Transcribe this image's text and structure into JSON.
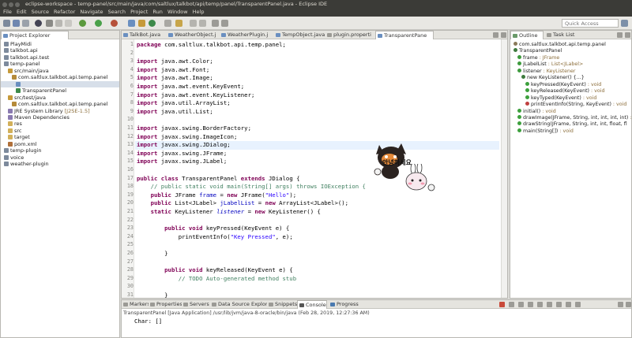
{
  "window": {
    "title": "eclipse-workspace - temp-panel/src/main/java/com/saltlux/talkbot/api/temp/panel/TransparentPanel.java - Eclipse IDE"
  },
  "menu": [
    "File",
    "Edit",
    "Source",
    "Refactor",
    "Navigate",
    "Search",
    "Project",
    "Run",
    "Window",
    "Help"
  ],
  "toolbar": {
    "quick_access_placeholder": "Quick Access"
  },
  "explorer": {
    "tab_label": "Project Explorer",
    "items": [
      {
        "label": "PlayMidi",
        "indent": 0,
        "icon": "project-icon"
      },
      {
        "label": "talkbot.api",
        "indent": 0,
        "icon": "project-icon"
      },
      {
        "label": "talkbot.api.test",
        "indent": 0,
        "icon": "project-icon"
      },
      {
        "label": "temp-panel",
        "indent": 0,
        "icon": "project-icon"
      },
      {
        "label": "src/main/java",
        "indent": 1,
        "icon": "source-folder-icon"
      },
      {
        "label": "com.saltlux.talkbot.api.temp.panel",
        "indent": 2,
        "icon": "package-icon"
      },
      {
        "label": "",
        "indent": 3,
        "icon": "java-file-icon",
        "selected": true
      },
      {
        "label": "TransparentPanel",
        "indent": 3,
        "icon": "class-icon"
      },
      {
        "label": "src/test/java",
        "indent": 1,
        "icon": "source-folder-icon"
      },
      {
        "label": "com.saltlux.talkbot.api.temp.panel",
        "indent": 2,
        "icon": "package-icon"
      },
      {
        "label": "JRE System Library",
        "suffix": "[J2SE-1.5]",
        "indent": 1,
        "icon": "library-icon"
      },
      {
        "label": "Maven Dependencies",
        "indent": 1,
        "icon": "library-icon"
      },
      {
        "label": "res",
        "indent": 1,
        "icon": "folder-icon"
      },
      {
        "label": "src",
        "indent": 1,
        "icon": "folder-icon"
      },
      {
        "label": "target",
        "indent": 1,
        "icon": "folder-icon"
      },
      {
        "label": "pom.xml",
        "indent": 1,
        "icon": "xml-file-icon"
      },
      {
        "label": "temp-plugin",
        "indent": 0,
        "icon": "project-icon"
      },
      {
        "label": "voice",
        "indent": 0,
        "icon": "project-icon"
      },
      {
        "label": "weather-plugin",
        "indent": 0,
        "icon": "project-icon"
      }
    ]
  },
  "editor": {
    "tabs": [
      {
        "label": "TalkBot.java"
      },
      {
        "label": "WeatherObject.j"
      },
      {
        "label": "WeatherPlugin.j"
      },
      {
        "label": "TempObject.java"
      },
      {
        "label": "plugin.properti"
      },
      {
        "label": "TransparentPane",
        "active": true
      }
    ],
    "line_numbers": [
      "1",
      "2",
      "3",
      "4",
      "5",
      "6",
      "7",
      "8",
      "9",
      "10",
      "11",
      "12",
      "13",
      "14",
      "15",
      "16",
      "17",
      "18",
      "19",
      "20",
      "21",
      "22",
      "23",
      "24",
      "25",
      "26",
      "27",
      "28",
      "29",
      "30",
      "31"
    ],
    "lines": [
      [
        {
          "t": "package",
          "c": "kw"
        },
        {
          "t": " com.saltlux.talkbot.api.temp.panel;"
        }
      ],
      [],
      [
        {
          "t": "import",
          "c": "kw"
        },
        {
          "t": " java.awt.Color;"
        }
      ],
      [
        {
          "t": "import",
          "c": "kw"
        },
        {
          "t": " java.awt.Font;"
        }
      ],
      [
        {
          "t": "import",
          "c": "kw"
        },
        {
          "t": " java.awt.Image;"
        }
      ],
      [
        {
          "t": "import",
          "c": "kw"
        },
        {
          "t": " java.awt.event.KeyEvent;"
        }
      ],
      [
        {
          "t": "import",
          "c": "kw"
        },
        {
          "t": " java.awt.event.KeyListener;"
        }
      ],
      [
        {
          "t": "import",
          "c": "kw"
        },
        {
          "t": " java.util.ArrayList;"
        }
      ],
      [
        {
          "t": "import",
          "c": "kw"
        },
        {
          "t": " java.util.List;"
        }
      ],
      [],
      [
        {
          "t": "import",
          "c": "kw"
        },
        {
          "t": " javax.swing.BorderFactory;"
        }
      ],
      [
        {
          "t": "import",
          "c": "kw"
        },
        {
          "t": " javax.swing.ImageIcon;"
        }
      ],
      [
        {
          "t": "import",
          "c": "kw"
        },
        {
          "t": " javax.swing.JDialog;"
        }
      ],
      [
        {
          "t": "import",
          "c": "kw"
        },
        {
          "t": " javax.swing.JFrame;"
        }
      ],
      [
        {
          "t": "import",
          "c": "kw"
        },
        {
          "t": " javax.swing.JLabel;"
        }
      ],
      [],
      [
        {
          "t": "public class",
          "c": "kw"
        },
        {
          "t": " TransparentPanel "
        },
        {
          "t": "extends",
          "c": "kw"
        },
        {
          "t": " JDialog {"
        }
      ],
      [
        {
          "t": "    // public static void main(String[] args) throws IOException {",
          "c": "cmt"
        }
      ],
      [
        {
          "t": "    "
        },
        {
          "t": "public",
          "c": "kw"
        },
        {
          "t": " JFrame "
        },
        {
          "t": "frame",
          "c": "fld"
        },
        {
          "t": " = "
        },
        {
          "t": "new",
          "c": "kw"
        },
        {
          "t": " JFrame("
        },
        {
          "t": "\"Hello\"",
          "c": "str"
        },
        {
          "t": ");"
        }
      ],
      [
        {
          "t": "    "
        },
        {
          "t": "public",
          "c": "kw"
        },
        {
          "t": " List<JLabel> "
        },
        {
          "t": "jLabelList",
          "c": "fld"
        },
        {
          "t": " = "
        },
        {
          "t": "new",
          "c": "kw"
        },
        {
          "t": " ArrayList<JLabel>();"
        }
      ],
      [
        {
          "t": "    "
        },
        {
          "t": "static",
          "c": "kw"
        },
        {
          "t": " KeyListener "
        },
        {
          "t": "listener",
          "c": "ital"
        },
        {
          "t": " = "
        },
        {
          "t": "new",
          "c": "kw"
        },
        {
          "t": " KeyListener() {"
        }
      ],
      [],
      [
        {
          "t": "        "
        },
        {
          "t": "public void",
          "c": "kw"
        },
        {
          "t": " keyPressed(KeyEvent e) {"
        }
      ],
      [
        {
          "t": "            printEventInfo("
        },
        {
          "t": "\"Key Pressed\"",
          "c": "str"
        },
        {
          "t": ", e);"
        }
      ],
      [],
      [
        {
          "t": "        }"
        }
      ],
      [],
      [
        {
          "t": "        "
        },
        {
          "t": "public void",
          "c": "kw"
        },
        {
          "t": " keyReleased(KeyEvent e) {"
        }
      ],
      [
        {
          "t": "            // TODO Auto-generated method stub",
          "c": "cmt"
        }
      ],
      [],
      [
        {
          "t": "        }"
        }
      ]
    ]
  },
  "sticker": {
    "caption": "안녕하세요"
  },
  "outline": {
    "tabs": [
      {
        "label": "Outline",
        "active": true
      },
      {
        "label": "Task List"
      }
    ],
    "items": [
      {
        "text": "com.saltlux.talkbot.api.temp.panel",
        "suffix": "",
        "indent": 0,
        "color": "#8a7a5a"
      },
      {
        "text": "TransparentPanel",
        "suffix": "",
        "indent": 0,
        "color": "#3d7a3d"
      },
      {
        "text": "frame",
        "suffix": " : JFrame",
        "indent": 1,
        "color": "#3d9a3d"
      },
      {
        "text": "jLabelList",
        "suffix": " : List<JLabel>",
        "indent": 1,
        "color": "#3d9a3d"
      },
      {
        "text": "listener",
        "suffix": " : KeyListener",
        "indent": 1,
        "color": "#3d9a3d"
      },
      {
        "text": "new KeyListener() {...}",
        "suffix": "",
        "indent": 2,
        "color": "#3d7a3d"
      },
      {
        "text": "keyPressed(KeyEvent)",
        "suffix": " : void",
        "indent": 3,
        "color": "#3da03d"
      },
      {
        "text": "keyReleased(KeyEvent)",
        "suffix": " : void",
        "indent": 3,
        "color": "#3da03d"
      },
      {
        "text": "keyTyped(KeyEvent)",
        "suffix": " : void",
        "indent": 3,
        "color": "#3da03d"
      },
      {
        "text": "printEventInfo(String, KeyEvent)",
        "suffix": " : void",
        "indent": 3,
        "color": "#c04040"
      },
      {
        "text": "initial()",
        "suffix": " : void",
        "indent": 1,
        "color": "#3da03d"
      },
      {
        "text": "drawImage(JFrame, String, int, int, int, int)",
        "suffix": " : void",
        "indent": 1,
        "color": "#3da03d"
      },
      {
        "text": "drawString(JFrame, String, int, int, float, fl",
        "suffix": "",
        "indent": 1,
        "color": "#3da03d"
      },
      {
        "text": "main(String[])",
        "suffix": " : void",
        "indent": 1,
        "color": "#3da03d"
      }
    ]
  },
  "console": {
    "tabs": [
      "Markers",
      "Properties",
      "Servers",
      "Data Source Explorer",
      "Snippets",
      "Console",
      "Progress"
    ],
    "active_tab": "Console",
    "launch_info": "TransparentPanel [Java Application] /usr/lib/jvm/java-8-oracle/bin/java (Feb 28, 2019, 12:27:36 AM)",
    "output": "Char: []"
  }
}
